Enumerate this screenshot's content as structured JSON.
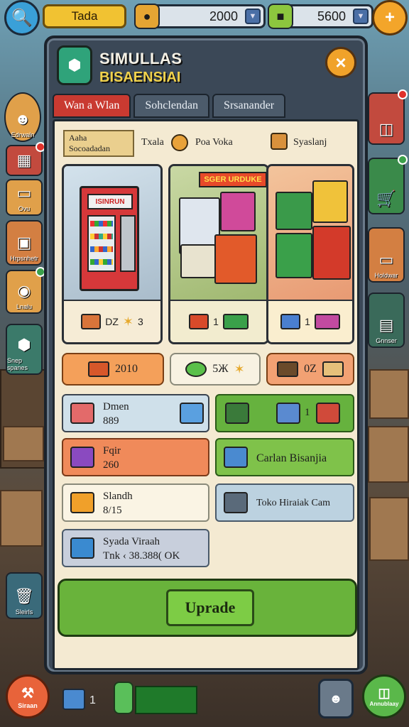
{
  "topbar": {
    "tab_label": "Tada",
    "coins": "2000",
    "cash": "5600",
    "plus": "+"
  },
  "side_left": [
    {
      "label": "Edrwaln"
    },
    {
      "label": ""
    },
    {
      "label": "Ovu"
    },
    {
      "label": "Hrpsnhetr"
    },
    {
      "label": "Lnalu"
    },
    {
      "label": "Snep spanes"
    },
    {
      "label": "Sleirls"
    }
  ],
  "side_right": [
    {
      "label": ""
    },
    {
      "label": ""
    },
    {
      "label": "Holdwar"
    },
    {
      "label": "Gnnser"
    }
  ],
  "panel": {
    "title1": "SIMULLAS",
    "title2": "BISAENSIAI",
    "close": "×",
    "tabs": [
      {
        "label": "Wan a Wlan",
        "active": true
      },
      {
        "label": "Sohclendan",
        "active": false
      },
      {
        "label": "Srsanander",
        "active": false
      }
    ],
    "filter": {
      "box_line1": "Aaha",
      "box_line2": "Socoadadan",
      "label1": "Txala",
      "label2": "Poa Voka",
      "label3": "Syaslanj"
    },
    "cards": [
      {
        "sign": "ISINRUN",
        "foot_text": "DZ",
        "foot_value": "3"
      },
      {
        "banner": "SGER URDUKE",
        "foot_value": "1"
      },
      {
        "foot_value": "1"
      }
    ],
    "prices": [
      {
        "label": "2010"
      },
      {
        "label": "5Ж"
      },
      {
        "label": "0Z"
      }
    ],
    "items": [
      {
        "line1": "Dmen",
        "line2": "889"
      },
      {
        "line1": "",
        "line2": "1"
      },
      {
        "line1": "Fqir",
        "line2": "260"
      },
      {
        "line1": "Carlan Bisanjia",
        "line2": ""
      },
      {
        "line1": "Slandh",
        "line2": "8/15"
      },
      {
        "line1": "Toko Hiraiak Cam",
        "line2": ""
      },
      {
        "line1": "Syada Viraah",
        "line2": "Tnk ‹ 38.388( OK"
      }
    ],
    "upgrade_label": "Uprade"
  },
  "bottombar": {
    "left_label": "Siraan",
    "qty": "1",
    "right_label": "Annublaay"
  },
  "colors": {
    "accent_red": "#c93a31",
    "accent_green": "#7dcc45",
    "accent_orange": "#f0a22a",
    "cream": "#f4ead2"
  }
}
